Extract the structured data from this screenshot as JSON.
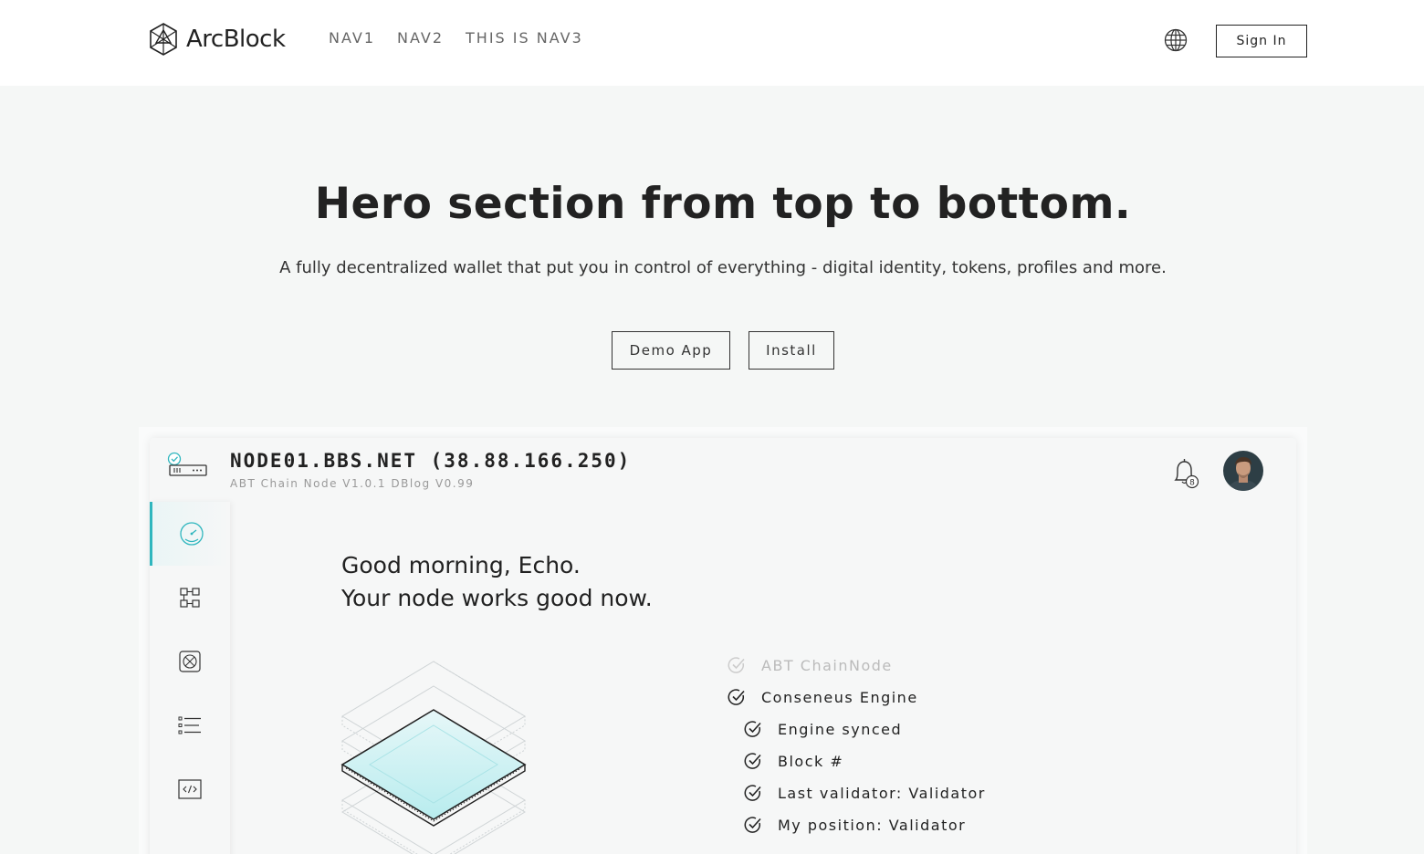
{
  "header": {
    "logo_text": "ArcBlock",
    "nav": [
      "NAV1",
      "NAV2",
      "THIS IS NAV3"
    ],
    "signin_label": "Sign In"
  },
  "hero": {
    "title": "Hero section from top to bottom.",
    "subtitle": "A fully decentralized wallet that put you in control of everything - digital identity, tokens, profiles and more.",
    "demo_label": "Demo App",
    "install_label": "Install"
  },
  "preview": {
    "node_title": "NODE01.BBS.NET (38.88.166.250)",
    "node_subtitle": "ABT Chain Node V1.0.1 DBlog V0.99",
    "notification_count": "8",
    "greeting_line1": "Good morning, Echo.",
    "greeting_line2": "Your node works good now.",
    "checklist": [
      {
        "label": "ABT ChainNode",
        "faded": true
      },
      {
        "label": "Conseneus Engine",
        "faded": false
      },
      {
        "label": "Engine synced",
        "faded": false
      },
      {
        "label": "Block #",
        "faded": false
      },
      {
        "label": "Last validator: Validator",
        "faded": false
      },
      {
        "label": "My position: Validator",
        "faded": false
      }
    ],
    "accent_color": "#2fb6be"
  }
}
